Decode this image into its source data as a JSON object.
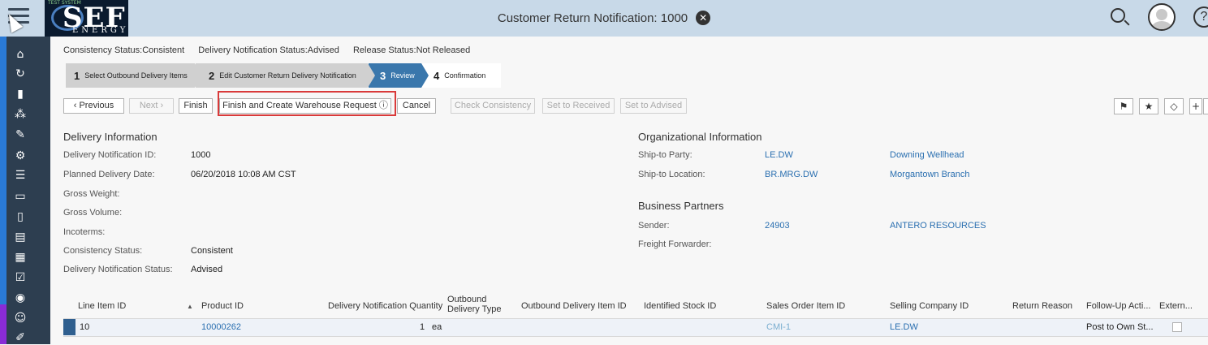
{
  "shell": {
    "title": "Customer Return Notification: 1000",
    "logo_top": "TEST SYSTEM",
    "logo_big": "SEF",
    "logo_small": "ENERGY",
    "help": "?"
  },
  "status": {
    "consistency": "Consistency Status:Consistent",
    "delivery": "Delivery Notification Status:Advised",
    "release": "Release Status:Not Released"
  },
  "steps": [
    {
      "num": "1",
      "label": "Select Outbound Delivery Items"
    },
    {
      "num": "2",
      "label": "Edit Customer Return Delivery Notification"
    },
    {
      "num": "3",
      "label": "Review"
    },
    {
      "num": "4",
      "label": "Confirmation"
    }
  ],
  "toolbar": {
    "previous": "Previous",
    "next": "Next",
    "finish": "Finish",
    "finish_create": "Finish and Create Warehouse Request",
    "cancel": "Cancel",
    "check": "Check Consistency",
    "set_received": "Set to Received",
    "set_advised": "Set to Advised"
  },
  "delivery_info": {
    "title": "Delivery Information",
    "fields": [
      {
        "label": "Delivery Notification ID:",
        "value": "1000"
      },
      {
        "label": "Planned Delivery Date:",
        "value": "06/20/2018 10:08 AM CST"
      },
      {
        "label": "Gross Weight:",
        "value": ""
      },
      {
        "label": "Gross Volume:",
        "value": ""
      },
      {
        "label": "Incoterms:",
        "value": ""
      },
      {
        "label": "Consistency Status:",
        "value": "Consistent"
      },
      {
        "label": "Delivery Notification Status:",
        "value": "Advised"
      }
    ]
  },
  "org_info": {
    "title": "Organizational Information",
    "fields": [
      {
        "label": "Ship-to Party:",
        "id": "LE.DW",
        "name": "Downing Wellhead"
      },
      {
        "label": "Ship-to Location:",
        "id": "BR.MRG.DW",
        "name": "Morgantown Branch"
      }
    ]
  },
  "partners": {
    "title": "Business Partners",
    "fields": [
      {
        "label": "Sender:",
        "id": "24903",
        "name": "ANTERO RESOURCES"
      },
      {
        "label": "Freight Forwarder:",
        "id": "",
        "name": ""
      }
    ]
  },
  "table": {
    "columns": [
      "Line Item ID",
      "Product ID",
      "Delivery Notification Quantity",
      "Outbound Delivery Type",
      "Outbound Delivery Item ID",
      "Identified Stock ID",
      "Sales Order Item ID",
      "Selling Company ID",
      "Return Reason",
      "Follow-Up Acti...",
      "Extern..."
    ],
    "rows": [
      {
        "line": "10",
        "product": "10000262",
        "qty": "1",
        "unit": "ea",
        "sales_order": "CMI-1",
        "company": "LE.DW",
        "followup": "Post to Own St..."
      }
    ]
  }
}
